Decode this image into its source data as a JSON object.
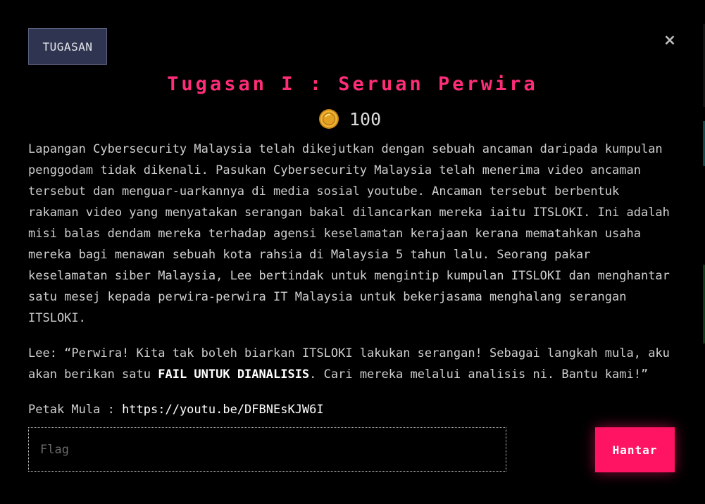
{
  "colors": {
    "accent": "#ff2d78",
    "button": "#ff1464",
    "tab_bg": "#2f3550",
    "background": "#000000",
    "text": "#cfcfcf"
  },
  "header": {
    "tab_label": "TUGASAN",
    "close_icon": "close-icon",
    "close_glyph": "×"
  },
  "challenge": {
    "title": "Tugasan I : Seruan Perwira",
    "coin_icon": "coin-icon",
    "points": "100"
  },
  "description": {
    "paragraph1": "Lapangan Cybersecurity Malaysia telah dikejutkan dengan sebuah ancaman daripada kumpulan penggodam tidak dikenali. Pasukan Cybersecurity Malaysia telah menerima video ancaman tersebut dan menguar-uarkannya di media sosial youtube. Ancaman tersebut berbentuk rakaman video yang menyatakan serangan bakal dilancarkan mereka iaitu ITSLOKI. Ini adalah misi balas dendam mereka terhadap agensi keselamatan kerajaan kerana mematahkan usaha mereka bagi menawan sebuah kota rahsia di Malaysia 5 tahun lalu. Seorang pakar keselamatan siber Malaysia, Lee bertindak untuk mengintip kumpulan ITSLOKI dan menghantar satu mesej kepada perwira-perwira IT Malaysia untuk bekerjasama menghalang serangan ITSLOKI.",
    "paragraph2_before": "Lee: “Perwira! Kita tak boleh biarkan ITSLOKI lakukan serangan! Sebagai langkah mula, aku akan berikan satu ",
    "paragraph2_bold": "FAIL UNTUK DIANALISIS",
    "paragraph2_after": ". Cari mereka melalui analisis ni. Bantu kami!”",
    "start_label": "Petak Mula : ",
    "start_link": "https://youtu.be/DFBNEsKJW6I"
  },
  "form": {
    "flag_placeholder": "Flag",
    "flag_value": "",
    "submit_label": "Hantar"
  }
}
